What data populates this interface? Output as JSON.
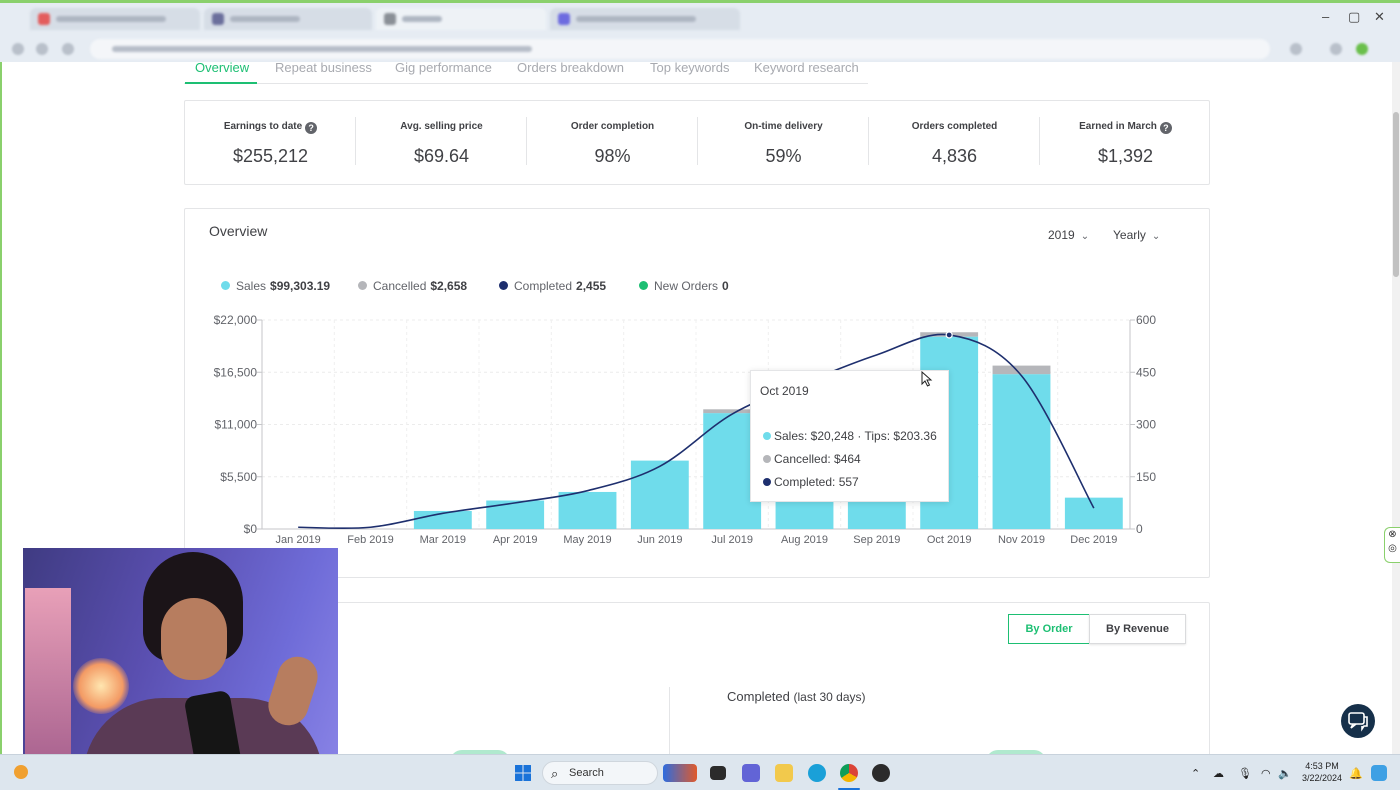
{
  "tabs": [
    {
      "label": "Overview",
      "active": true
    },
    {
      "label": "Repeat business"
    },
    {
      "label": "Gig performance"
    },
    {
      "label": "Orders breakdown"
    },
    {
      "label": "Top keywords"
    },
    {
      "label": "Keyword research"
    }
  ],
  "stats": [
    {
      "label": "Earnings to date",
      "value": "$255,212",
      "help": true
    },
    {
      "label": "Avg. selling price",
      "value": "$69.64"
    },
    {
      "label": "Order completion",
      "value": "98%"
    },
    {
      "label": "On-time delivery",
      "value": "59%"
    },
    {
      "label": "Orders completed",
      "value": "4,836"
    },
    {
      "label": "Earned in March",
      "value": "$1,392",
      "help": true
    }
  ],
  "overview": {
    "title": "Overview",
    "year": "2019",
    "period": "Yearly",
    "legend": [
      {
        "name": "Sales",
        "value": "$99,303.19",
        "color": "#6fdceb"
      },
      {
        "name": "Cancelled",
        "value": "$2,658",
        "color": "#b5b6ba"
      },
      {
        "name": "Completed",
        "value": "2,455",
        "color": "#1e2f6e"
      },
      {
        "name": "New Orders",
        "value": "0",
        "color": "#1dbf73"
      }
    ]
  },
  "chart_data": {
    "type": "bar",
    "categories": [
      "Jan 2019",
      "Feb 2019",
      "Mar 2019",
      "Apr 2019",
      "May 2019",
      "Jun 2019",
      "Jul 2019",
      "Aug 2019",
      "Sep 2019",
      "Oct 2019",
      "Nov 2019",
      "Dec 2019"
    ],
    "series": [
      {
        "name": "Sales",
        "axis": "left",
        "values": [
          0,
          0,
          1900,
          3000,
          3900,
          7200,
          12200,
          12200,
          12200,
          20248,
          16300,
          3300
        ]
      },
      {
        "name": "Cancelled",
        "axis": "left",
        "values": [
          0,
          0,
          0,
          0,
          0,
          0,
          400,
          0,
          0,
          464,
          900,
          0
        ]
      },
      {
        "name": "Completed",
        "type": "line",
        "axis": "right",
        "values": [
          5,
          5,
          45,
          75,
          110,
          180,
          330,
          420,
          500,
          557,
          440,
          60
        ]
      }
    ],
    "y_left": {
      "ticks": [
        "$0",
        "$5,500",
        "$11,000",
        "$16,500",
        "$22,000"
      ],
      "range": [
        0,
        22000
      ]
    },
    "y_right": {
      "ticks": [
        "0",
        "150",
        "300",
        "450",
        "600"
      ],
      "range": [
        0,
        600
      ]
    },
    "grid": true
  },
  "tooltip": {
    "title": "Oct 2019",
    "sales": "Sales: $20,248 · Tips: $203.36",
    "cancelled": "Cancelled: $464",
    "completed": "Completed: 557"
  },
  "orders_section": {
    "by_order": "By Order",
    "by_revenue": "By Revenue",
    "completed_title": "Completed",
    "completed_sub": "(last 30 days)"
  },
  "taskbar": {
    "search": "Search",
    "time": "4:53 PM",
    "date": "3/22/2024"
  }
}
